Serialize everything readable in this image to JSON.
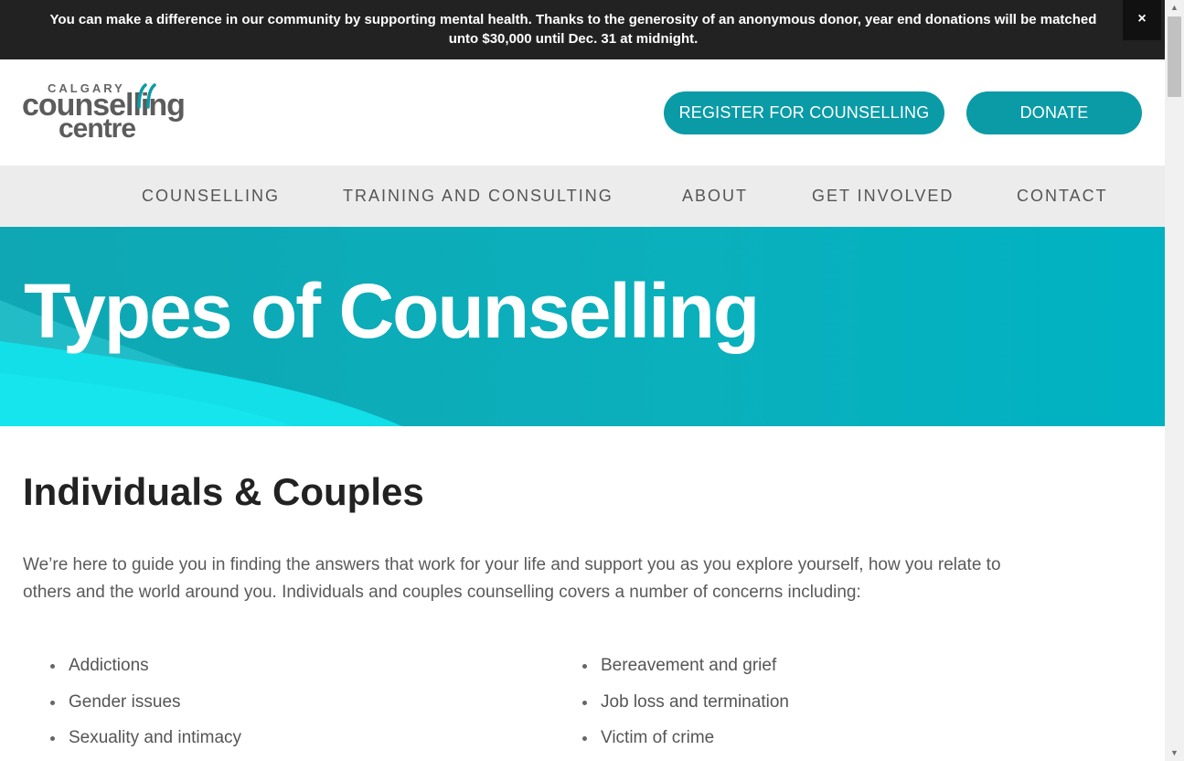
{
  "announcement": {
    "text": "You can make a difference in our community by supporting mental health. Thanks to the generosity of an anonymous donor, year end donations will be matched unto $30,000 until Dec. 31 at midnight.",
    "close_label": "×"
  },
  "logo": {
    "small": "CALGARY",
    "main": "counselling",
    "sub": "centre"
  },
  "header": {
    "register_label": "REGISTER FOR COUNSELLING",
    "donate_label": "DONATE"
  },
  "nav": {
    "items": [
      {
        "label": "COUNSELLING"
      },
      {
        "label": "TRAINING AND CONSULTING"
      },
      {
        "label": "ABOUT"
      },
      {
        "label": "GET INVOLVED"
      },
      {
        "label": "CONTACT"
      }
    ]
  },
  "hero": {
    "title": "Types of Counselling"
  },
  "main": {
    "section_title": "Individuals & Couples",
    "intro": "We’re here to guide you in finding the answers that work for your life and support you as you explore yourself, how you relate to others and the world around you. Individuals and couples counselling covers a number of concerns including:",
    "left_list": [
      "Addictions",
      "Gender issues",
      "Sexuality and intimacy"
    ],
    "right_list": [
      "Bereavement and grief",
      "Job loss and termination",
      "Victim of crime"
    ]
  },
  "colors": {
    "accent": "#0a9ba6",
    "announce_bg": "#222222",
    "nav_bg": "#ececec"
  }
}
